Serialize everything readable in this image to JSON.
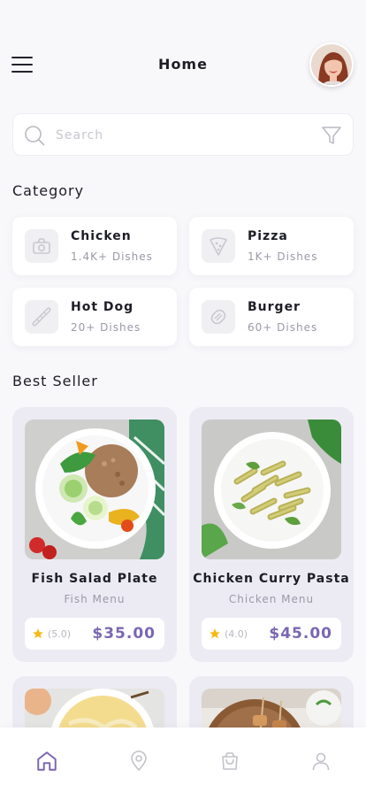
{
  "header": {
    "title": "Home"
  },
  "search": {
    "placeholder": "Search"
  },
  "category": {
    "title": "Category",
    "items": [
      {
        "name": "Chicken",
        "count": "1.4K+ Dishes",
        "icon": "chicken-icon"
      },
      {
        "name": "Pizza",
        "count": "1K+ Dishes",
        "icon": "pizza-icon"
      },
      {
        "name": "Hot Dog",
        "count": "20+ Dishes",
        "icon": "hot-dog-icon"
      },
      {
        "name": "Burger",
        "count": "60+ Dishes",
        "icon": "burger-icon"
      }
    ]
  },
  "best_seller": {
    "title": "Best Seller",
    "items": [
      {
        "name": "Fish Salad Plate",
        "menu": "Fish Menu",
        "rating": "(5.0)",
        "price": "$35.00"
      },
      {
        "name": "Chicken Curry Pasta",
        "menu": "Chicken Menu",
        "rating": "(4.0)",
        "price": "$45.00"
      }
    ]
  },
  "bottom_nav": {
    "items": [
      {
        "icon": "home-icon",
        "active": true
      },
      {
        "icon": "location-icon",
        "active": false
      },
      {
        "icon": "shopping-bag-icon",
        "active": false
      },
      {
        "icon": "profile-icon",
        "active": false
      }
    ]
  },
  "colors": {
    "accent": "#7a66b3",
    "star": "#f5b914",
    "card_bg": "#ecebf3"
  }
}
